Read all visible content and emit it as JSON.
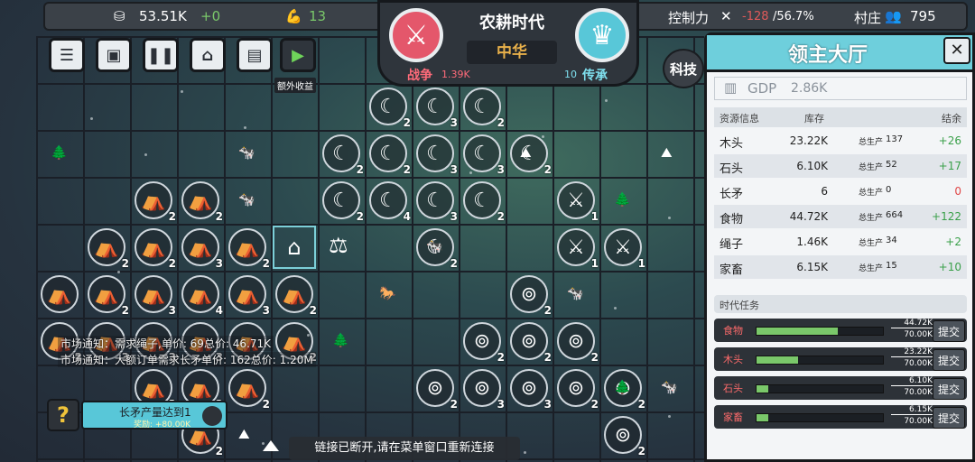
{
  "topbar": {
    "money": "53.51K",
    "money_delta": "+0",
    "strength": "13",
    "control_label": "控制力",
    "control_value": "-128",
    "control_pct": "/56.7%",
    "village_label": "村庄",
    "village_count": "795"
  },
  "era": {
    "title": "农耕时代",
    "civ": "中华",
    "war_label": "战争",
    "war_value": "1.39K",
    "legacy_value": "10",
    "legacy_label": "传承"
  },
  "toolbar": {
    "extra_income_label": "额外收益",
    "tech_label": "科技"
  },
  "panel": {
    "title": "领主大厅",
    "close": "✕",
    "gdp_label": "GDP",
    "gdp_value": "2.86K",
    "table_headers": [
      "资源信息",
      "库存",
      "结余"
    ],
    "resources": [
      {
        "name": "木头",
        "stock": "23.22K",
        "prod_label": "总生产",
        "prod": "137",
        "net": "+26",
        "color": "#3aa04a"
      },
      {
        "name": "石头",
        "stock": "6.10K",
        "prod_label": "总生产",
        "prod": "52",
        "net": "+17",
        "color": "#3aa04a"
      },
      {
        "name": "长矛",
        "stock": "6",
        "prod_label": "总生产",
        "prod": "0",
        "net": "0",
        "color": "#e04848"
      },
      {
        "name": "食物",
        "stock": "44.72K",
        "prod_label": "总生产",
        "prod": "664",
        "net": "+122",
        "color": "#3aa04a"
      },
      {
        "name": "绳子",
        "stock": "1.46K",
        "prod_label": "总生产",
        "prod": "34",
        "net": "+2",
        "color": "#3aa04a"
      },
      {
        "name": "家畜",
        "stock": "6.15K",
        "prod_label": "总生产",
        "prod": "15",
        "net": "+10",
        "color": "#3aa04a"
      }
    ],
    "era_tasks_label": "时代任务",
    "tasks": [
      {
        "name": "食物",
        "cur": "44.72K",
        "goal": "70.00K",
        "progress": 0.64,
        "btn": "提交"
      },
      {
        "name": "木头",
        "cur": "23.22K",
        "goal": "70.00K",
        "progress": 0.33,
        "btn": "提交"
      },
      {
        "name": "石头",
        "cur": "6.10K",
        "goal": "70.00K",
        "progress": 0.09,
        "btn": "提交"
      },
      {
        "name": "家畜",
        "cur": "6.15K",
        "goal": "70.00K",
        "progress": 0.09,
        "btn": "提交"
      }
    ]
  },
  "notices": {
    "market1": "市场通知：需求绳子,单价: 69总价: 46.71K",
    "market2": "市场通知：大额订单需求长矛单价: 162总价: 1.20M"
  },
  "quest": {
    "help": "?",
    "text": "长矛产量达到1",
    "reward": "奖励: +80.00K"
  },
  "status": {
    "disconnect": "链接已断开,请在菜单窗口重新连接"
  },
  "map": {
    "tiles": [
      {
        "c": 7,
        "r": 1,
        "t": "scythe",
        "n": "2"
      },
      {
        "c": 8,
        "r": 1,
        "t": "scythe",
        "n": "3"
      },
      {
        "c": 9,
        "r": 1,
        "t": "scythe",
        "n": "2"
      },
      {
        "c": 6,
        "r": 2,
        "t": "scythe",
        "n": "2"
      },
      {
        "c": 7,
        "r": 2,
        "t": "scythe",
        "n": "2"
      },
      {
        "c": 8,
        "r": 2,
        "t": "scythe",
        "n": "3"
      },
      {
        "c": 9,
        "r": 2,
        "t": "scythe",
        "n": "3"
      },
      {
        "c": 10,
        "r": 2,
        "t": "scythe",
        "n": "2"
      },
      {
        "c": 2,
        "r": 3,
        "t": "tent",
        "n": "2"
      },
      {
        "c": 3,
        "r": 3,
        "t": "tent",
        "n": "2"
      },
      {
        "c": 6,
        "r": 3,
        "t": "scythe",
        "n": "2"
      },
      {
        "c": 7,
        "r": 3,
        "t": "scythe",
        "n": "4"
      },
      {
        "c": 8,
        "r": 3,
        "t": "scythe",
        "n": "3"
      },
      {
        "c": 9,
        "r": 3,
        "t": "scythe",
        "n": "2"
      },
      {
        "c": 11,
        "r": 3,
        "t": "spear",
        "n": "1"
      },
      {
        "c": 1,
        "r": 4,
        "t": "tent",
        "n": "2"
      },
      {
        "c": 2,
        "r": 4,
        "t": "tent",
        "n": "2"
      },
      {
        "c": 3,
        "r": 4,
        "t": "tent",
        "n": "3"
      },
      {
        "c": 4,
        "r": 4,
        "t": "tent",
        "n": "2"
      },
      {
        "c": 8,
        "r": 4,
        "t": "scythe",
        "n": "2"
      },
      {
        "c": 11,
        "r": 4,
        "t": "spear",
        "n": "1"
      },
      {
        "c": 12,
        "r": 4,
        "t": "spear",
        "n": "1"
      },
      {
        "c": 0,
        "r": 5,
        "t": "tent",
        "n": ""
      },
      {
        "c": 1,
        "r": 5,
        "t": "tent",
        "n": "2"
      },
      {
        "c": 2,
        "r": 5,
        "t": "tent",
        "n": "3"
      },
      {
        "c": 3,
        "r": 5,
        "t": "tent",
        "n": "4"
      },
      {
        "c": 4,
        "r": 5,
        "t": "tent",
        "n": "3"
      },
      {
        "c": 5,
        "r": 5,
        "t": "tent",
        "n": "2"
      },
      {
        "c": 10,
        "r": 5,
        "t": "rope",
        "n": "2"
      },
      {
        "c": 0,
        "r": 6,
        "t": "tent",
        "n": "2"
      },
      {
        "c": 1,
        "r": 6,
        "t": "tent",
        "n": "3"
      },
      {
        "c": 2,
        "r": 6,
        "t": "tent",
        "n": "3"
      },
      {
        "c": 3,
        "r": 6,
        "t": "tent",
        "n": "3"
      },
      {
        "c": 4,
        "r": 6,
        "t": "tent",
        "n": ""
      },
      {
        "c": 5,
        "r": 6,
        "t": "tent",
        "n": "2"
      },
      {
        "c": 9,
        "r": 6,
        "t": "rope",
        "n": "2"
      },
      {
        "c": 10,
        "r": 6,
        "t": "rope",
        "n": "2"
      },
      {
        "c": 11,
        "r": 6,
        "t": "rope",
        "n": "2"
      },
      {
        "c": 2,
        "r": 7,
        "t": "tent",
        "n": "3"
      },
      {
        "c": 3,
        "r": 7,
        "t": "tent",
        "n": "3"
      },
      {
        "c": 4,
        "r": 7,
        "t": "tent",
        "n": "2"
      },
      {
        "c": 8,
        "r": 7,
        "t": "rope",
        "n": "2"
      },
      {
        "c": 9,
        "r": 7,
        "t": "rope",
        "n": "3"
      },
      {
        "c": 10,
        "r": 7,
        "t": "rope",
        "n": "3"
      },
      {
        "c": 11,
        "r": 7,
        "t": "rope",
        "n": "2"
      },
      {
        "c": 12,
        "r": 7,
        "t": "rope",
        "n": "2"
      },
      {
        "c": 3,
        "r": 8,
        "t": "tent",
        "n": "2"
      },
      {
        "c": 12,
        "r": 8,
        "t": "rope",
        "n": "2"
      }
    ]
  }
}
